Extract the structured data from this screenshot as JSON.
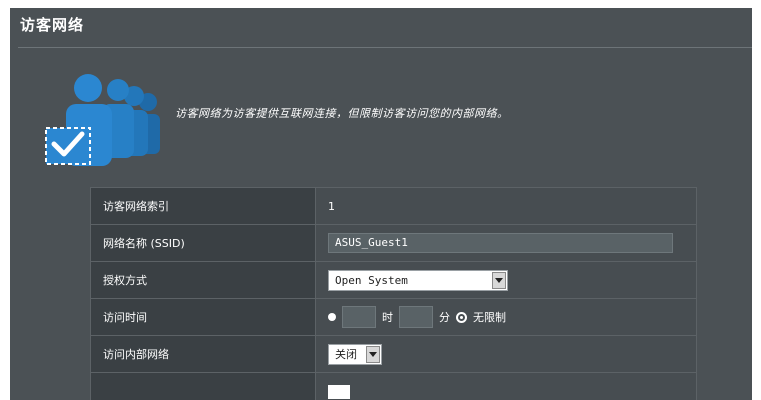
{
  "panel": {
    "title": "访客网络",
    "intro": "访客网络为访客提供互联网连接，但限制访客访问您的内部网络。"
  },
  "icons": {
    "guest_group": "guest-network-icon"
  },
  "settings": {
    "rows": [
      {
        "label": "访客网络索引",
        "value": "1"
      },
      {
        "label": "网络名称 (SSID)",
        "value": "ASUS_Guest1"
      },
      {
        "label": "授权方式",
        "value": "Open System"
      },
      {
        "label": "访问时间",
        "hour_unit": "时",
        "minute_unit": "分",
        "unlimited_label": "无限制"
      },
      {
        "label": "访问内部网络",
        "value": "关闭"
      }
    ]
  },
  "colors": {
    "panel_bg": "#4b5155",
    "label_cell": "#3a4044",
    "value_cell": "#474d51",
    "icon_blue": "#2b87d1"
  }
}
